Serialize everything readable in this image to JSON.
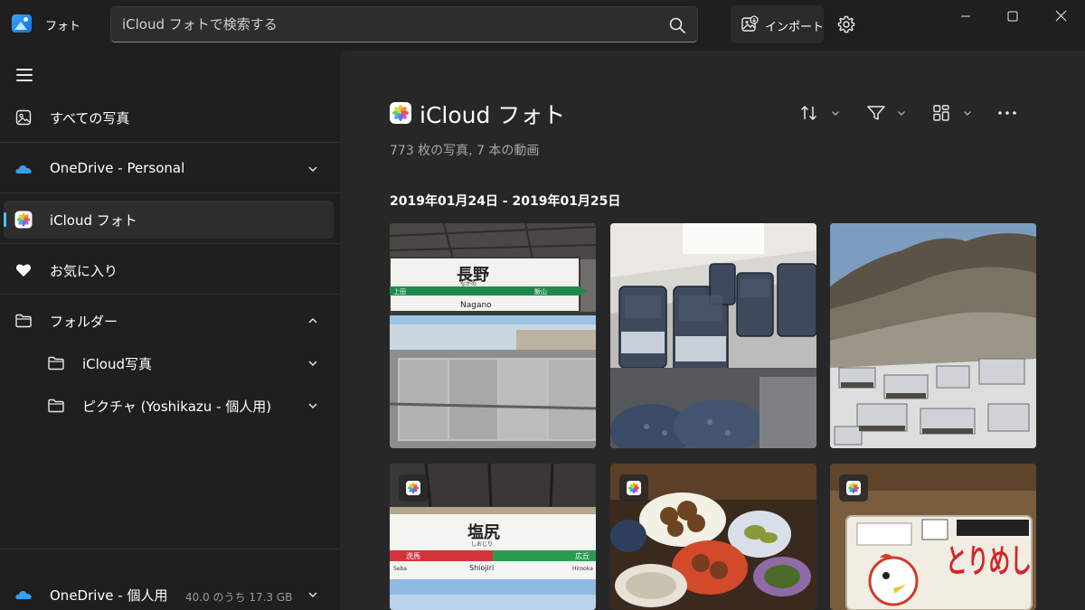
{
  "app": {
    "title": "フォト",
    "search_placeholder": "iCloud フォトで検索する",
    "import_label": "インポート",
    "icons": [
      "photos-app-icon",
      "search-icon",
      "import-icon",
      "gear-icon",
      "minimize-icon",
      "maximize-icon",
      "close-icon"
    ]
  },
  "sidebar": {
    "items": [
      {
        "label": "すべての写真",
        "icon": "gallery-icon"
      },
      {
        "label": "OneDrive - Personal",
        "icon": "onedrive-cloud-icon",
        "chevron": "down"
      },
      {
        "label": "iCloud フォト",
        "icon": "icloud-photos-icon",
        "active": true
      },
      {
        "label": "お気に入り",
        "icon": "heart-icon"
      },
      {
        "label": "フォルダー",
        "icon": "folder-icon",
        "chevron": "up"
      },
      {
        "label": "iCloud写真",
        "icon": "folder-icon",
        "chevron": "down",
        "sub": true
      },
      {
        "label": "ピクチャ (Yoshikazu - 個人用)",
        "icon": "folder-icon",
        "chevron": "down",
        "sub": true
      }
    ],
    "footer": {
      "label": "OneDrive - 個人用",
      "storage": "40.0 のうち 17.3 GB"
    }
  },
  "main": {
    "title": "iCloud フォト",
    "subtitle": "773 枚の写真, 7 本の動画",
    "toolbar": [
      "sort-icon",
      "filter-icon",
      "view-layout-icon",
      "more-icon"
    ],
    "date_range": "2019年01月24日 - 2019年01月25日",
    "photos": [
      {
        "name": "nagano-station-sign",
        "sign_kanji": "長野",
        "sign_romaji": "Nagano",
        "left_station": "上田",
        "right_station": "飯山",
        "hiragana": "ながの"
      },
      {
        "name": "train-interior-seats"
      },
      {
        "name": "snowy-mountain-village"
      },
      {
        "name": "shiojiri-station-sign",
        "sign_kanji": "塩尻",
        "sign_romaji": "Shiojiri",
        "left_station": "洗馬",
        "right_station": "広丘",
        "left_romaji": "Seba",
        "right_romaji": "Hirooka",
        "hiragana": "しおじり"
      },
      {
        "name": "japanese-dinner-dishes"
      },
      {
        "name": "tori-meshi-bento",
        "box_text": "とりめし"
      }
    ]
  },
  "colors": {
    "accent": "#4cc2ff",
    "background": "#1f1f1f",
    "content_bg": "#272727"
  }
}
